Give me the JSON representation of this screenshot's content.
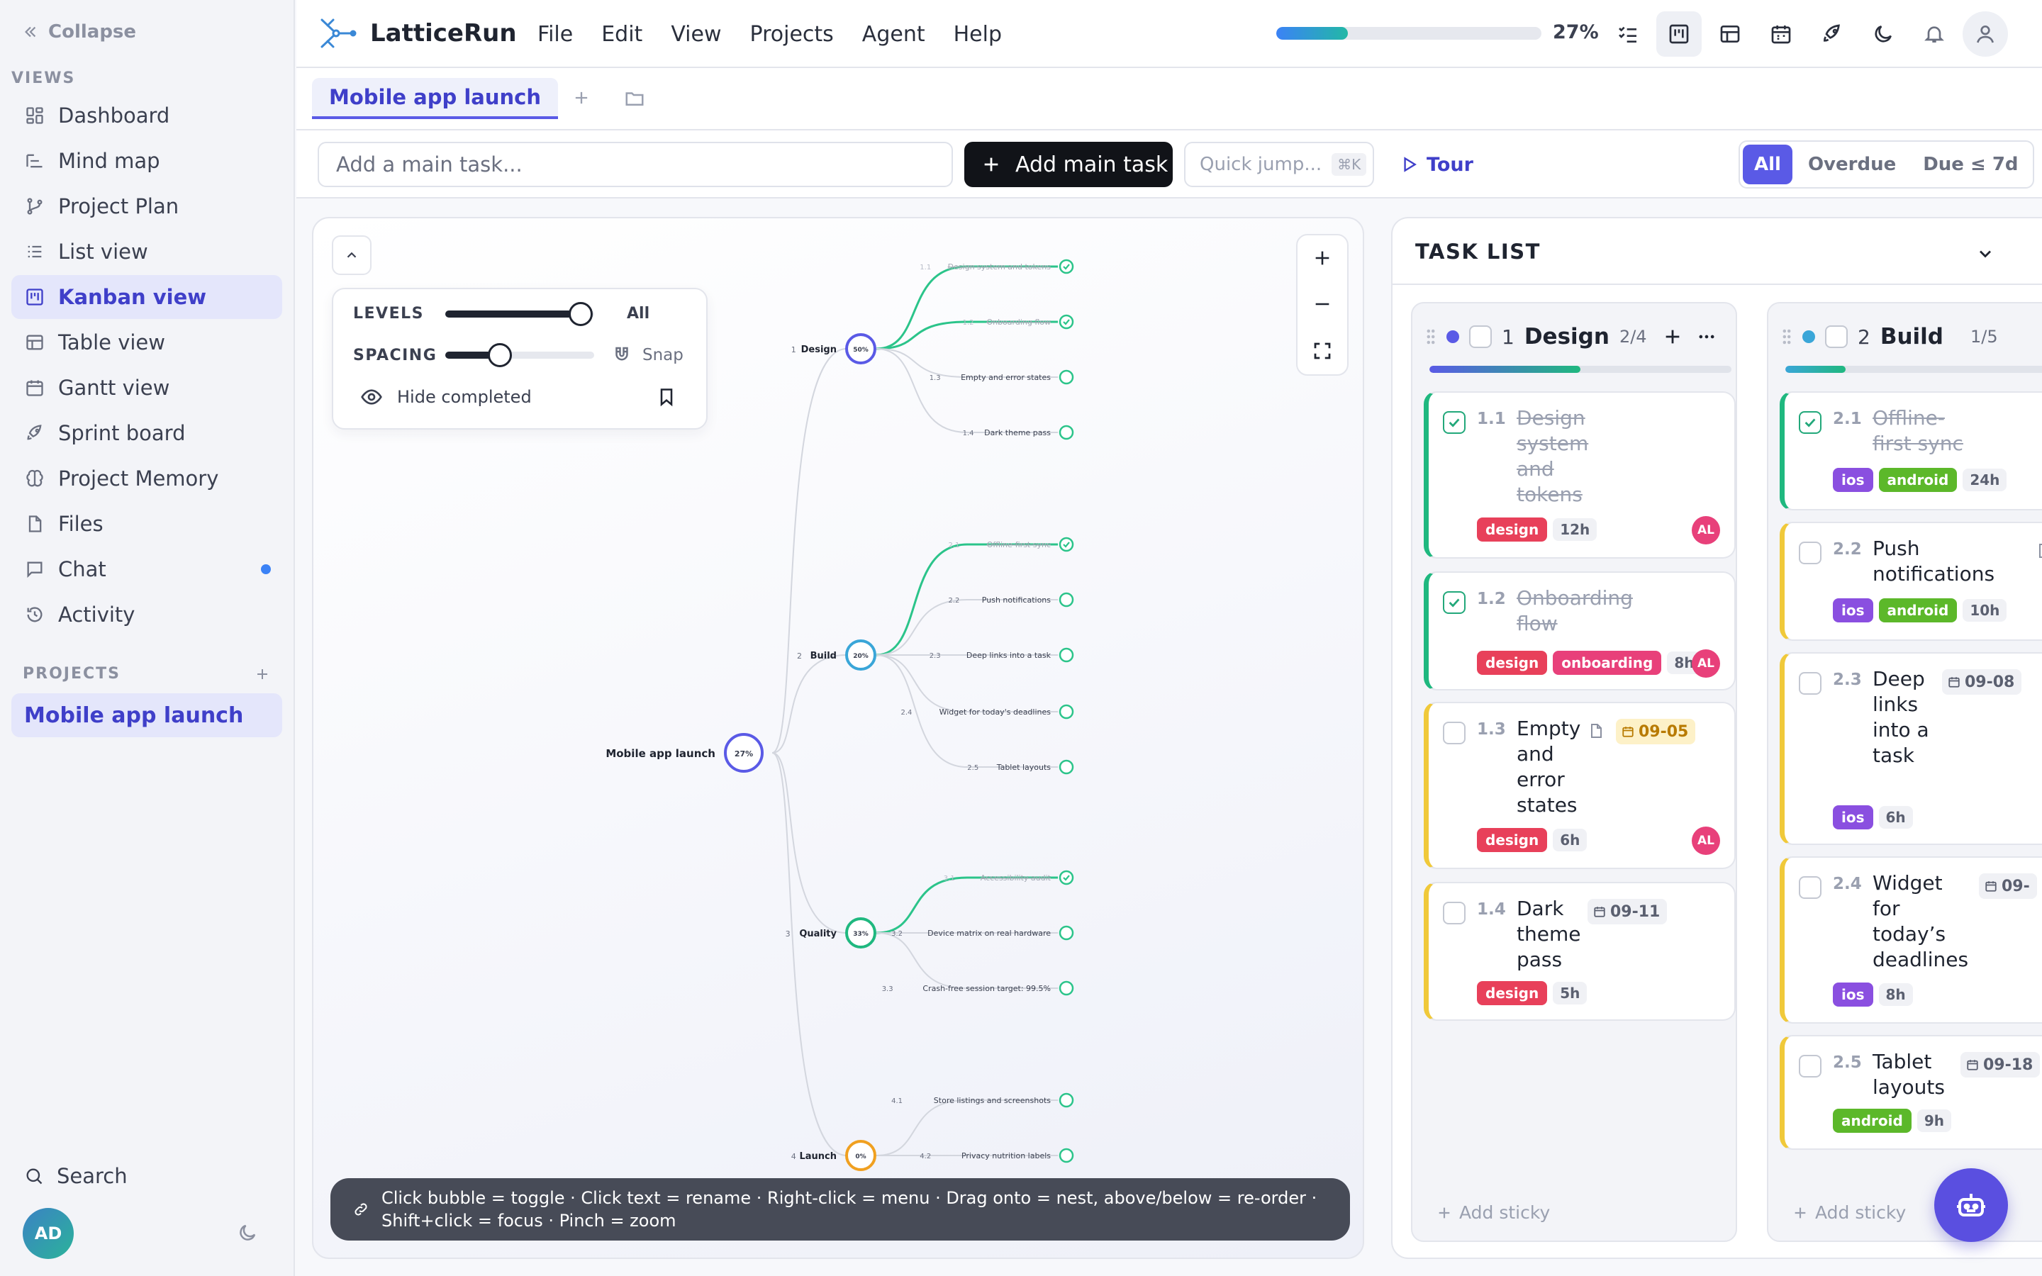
{
  "sidebar": {
    "collapse_label": "Collapse",
    "views_label": "VIEWS",
    "items": [
      {
        "label": "Dashboard"
      },
      {
        "label": "Mind map"
      },
      {
        "label": "Project Plan"
      },
      {
        "label": "List view"
      },
      {
        "label": "Kanban view"
      },
      {
        "label": "Table view"
      },
      {
        "label": "Gantt view"
      },
      {
        "label": "Sprint board"
      },
      {
        "label": "Project Memory"
      },
      {
        "label": "Files"
      },
      {
        "label": "Chat"
      },
      {
        "label": "Activity"
      }
    ],
    "active_item": "Kanban view",
    "projects_label": "PROJECTS",
    "project": "Mobile app launch",
    "search_label": "Search",
    "user_initials": "AD"
  },
  "topbar": {
    "app_name": "LatticeRun",
    "menu": [
      "File",
      "Edit",
      "View",
      "Projects",
      "Agent",
      "Help"
    ],
    "progress": 0.27,
    "progress_label": "27%"
  },
  "tabs": {
    "active": "Mobile app launch"
  },
  "toolbar": {
    "task_placeholder": "Add a main task...",
    "add_main_label": "Add main task",
    "quick_jump_label": "Quick jump...",
    "quick_jump_kbd": "⌘K",
    "tour_label": "Tour",
    "filters": [
      "All",
      "Overdue",
      "Due ≤ 7d"
    ],
    "active_filter": "All"
  },
  "mindmap": {
    "levels_label": "LEVELS",
    "levels_value": "All",
    "spacing_label": "SPACING",
    "snap_label": "Snap",
    "hide_completed_label": "Hide completed",
    "hint": "Click bubble = toggle · Click text = rename · Right-click = menu · Drag onto = nest, above/below = re-order · Shift+click = focus · Pinch = zoom",
    "root": {
      "label": "Mobile app launch",
      "percent": "27%"
    },
    "groups": [
      {
        "num": "1",
        "label": "Design",
        "percent": "50%",
        "color": "#5a5ae6",
        "children": [
          {
            "id": "1.1",
            "label": "Design system and tokens",
            "done": true
          },
          {
            "id": "1.2",
            "label": "Onboarding flow",
            "done": true
          },
          {
            "id": "1.3",
            "label": "Empty and error states",
            "done": false
          },
          {
            "id": "1.4",
            "label": "Dark theme pass",
            "done": false
          }
        ]
      },
      {
        "num": "2",
        "label": "Build",
        "percent": "20%",
        "color": "#3aa6d8",
        "children": [
          {
            "id": "2.1",
            "label": "Offline-first sync",
            "done": true
          },
          {
            "id": "2.2",
            "label": "Push notifications",
            "done": false
          },
          {
            "id": "2.3",
            "label": "Deep links into a task",
            "done": false
          },
          {
            "id": "2.4",
            "label": "Widget for today's deadlines",
            "done": false
          },
          {
            "id": "2.5",
            "label": "Tablet layouts",
            "done": false
          }
        ]
      },
      {
        "num": "3",
        "label": "Quality",
        "percent": "33%",
        "color": "#1fb87f",
        "children": [
          {
            "id": "3.1",
            "label": "Accessibility audit",
            "done": true
          },
          {
            "id": "3.2",
            "label": "Device matrix on real hardware",
            "done": false
          },
          {
            "id": "3.3",
            "label": "Crash-free session target: 99.5%",
            "done": false
          }
        ]
      },
      {
        "num": "4",
        "label": "Launch",
        "percent": "0%",
        "color": "#f0a020",
        "children": [
          {
            "id": "4.1",
            "label": "Store listings and screenshots",
            "done": false
          },
          {
            "id": "4.2",
            "label": "Privacy nutrition labels",
            "done": false
          }
        ]
      }
    ]
  },
  "tasklist": {
    "title": "TASK LIST",
    "add_sticky_label": "Add sticky",
    "columns": [
      {
        "num": "1",
        "name": "Design",
        "count": "2/4",
        "progress": 0.5,
        "color": "#5a5ae6",
        "cards": [
          {
            "id": "1.1",
            "title": "Design system and tokens",
            "done": true,
            "tags": [
              "design"
            ],
            "estimate": "12h",
            "assignee": "AL"
          },
          {
            "id": "1.2",
            "title": "Onboarding flow",
            "done": true,
            "tags": [
              "design",
              "onboarding"
            ],
            "estimate": "8h",
            "assignee": "AL"
          },
          {
            "id": "1.3",
            "title": "Empty and error states",
            "done": false,
            "due": "09-05",
            "tags": [
              "design"
            ],
            "estimate": "6h",
            "assignee": "AL"
          },
          {
            "id": "1.4",
            "title": "Dark theme pass",
            "done": false,
            "due": "09-11",
            "tags": [
              "design"
            ],
            "estimate": "5h"
          }
        ]
      },
      {
        "num": "2",
        "name": "Build",
        "count": "1/5",
        "progress": 0.2,
        "color": "#3aa6d8",
        "cards": [
          {
            "id": "2.1",
            "title": "Offline-first sync",
            "done": true,
            "tags": [
              "ios",
              "android"
            ],
            "estimate": "24h"
          },
          {
            "id": "2.2",
            "title": "Push notifications",
            "done": false,
            "tags": [
              "ios",
              "android"
            ],
            "estimate": "10h"
          },
          {
            "id": "2.3",
            "title": "Deep links into a task",
            "done": false,
            "due": "09-08",
            "tags": [
              "ios"
            ],
            "estimate": "6h"
          },
          {
            "id": "2.4",
            "title": "Widget for today’s deadlines",
            "done": false,
            "due": "09-",
            "tags": [
              "ios"
            ],
            "estimate": "8h"
          },
          {
            "id": "2.5",
            "title": "Tablet layouts",
            "done": false,
            "due": "09-18",
            "tags": [
              "android"
            ],
            "estimate": "9h"
          }
        ]
      }
    ]
  },
  "colors": {
    "accent": "#5a5ae6",
    "tag_design": "#e8405a",
    "tag_onboarding": "#e8407a",
    "tag_ios": "#8a4fe0",
    "tag_android": "#5cb82a"
  }
}
